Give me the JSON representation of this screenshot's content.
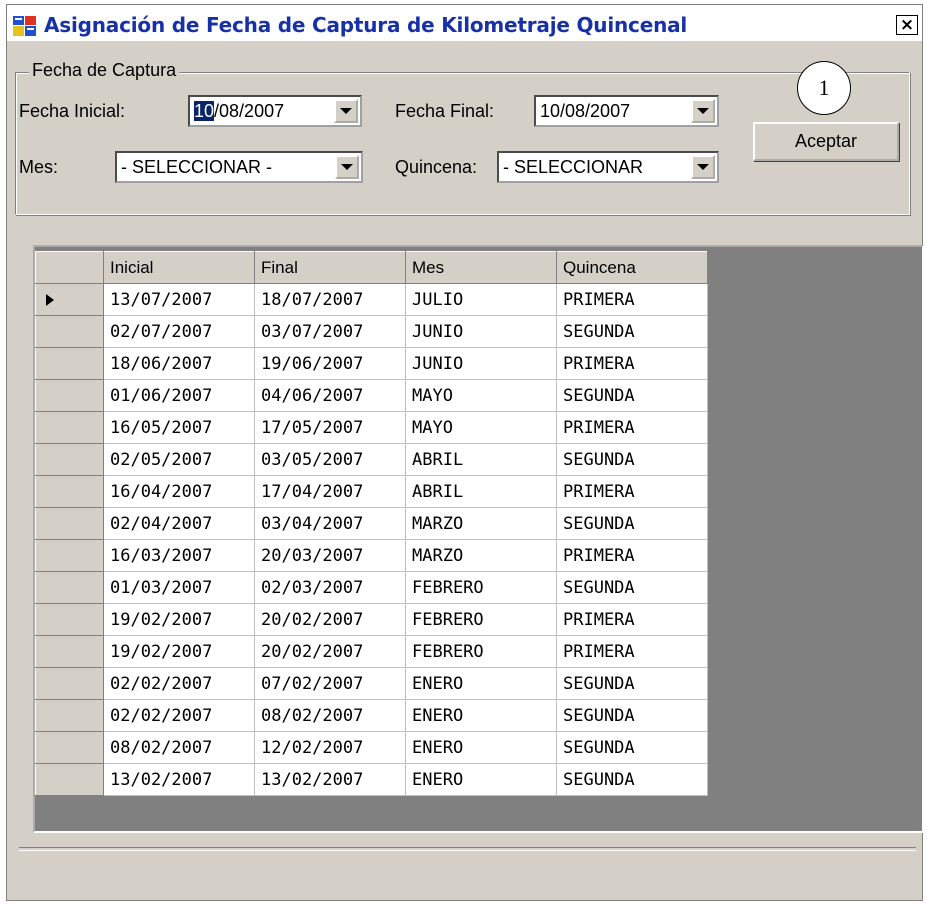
{
  "window": {
    "title": "Asignación de Fecha de Captura de Kilometraje Quincenal",
    "close_label": "×"
  },
  "group": {
    "legend": "Fecha de Captura",
    "fecha_inicial_label": "Fecha Inicial:",
    "fecha_inicial_selected": "10",
    "fecha_inicial_rest": "/08/2007",
    "fecha_final_label": "Fecha Final:",
    "fecha_final_value": "10/08/2007",
    "mes_label": "Mes:",
    "mes_value": "- SELECCIONAR -",
    "quincena_label": "Quincena:",
    "quincena_value": "- SELECCIONAR"
  },
  "accept_button": "Aceptar",
  "callout_number": "1",
  "grid": {
    "columns": [
      "Inicial",
      "Final",
      "Mes",
      "Quincena"
    ],
    "rows": [
      [
        "13/07/2007",
        "18/07/2007",
        "JULIO",
        "PRIMERA"
      ],
      [
        "02/07/2007",
        "03/07/2007",
        "JUNIO",
        "SEGUNDA"
      ],
      [
        "18/06/2007",
        "19/06/2007",
        "JUNIO",
        "PRIMERA"
      ],
      [
        "01/06/2007",
        "04/06/2007",
        "MAYO",
        "SEGUNDA"
      ],
      [
        "16/05/2007",
        "17/05/2007",
        "MAYO",
        "PRIMERA"
      ],
      [
        "02/05/2007",
        "03/05/2007",
        "ABRIL",
        "SEGUNDA"
      ],
      [
        "16/04/2007",
        "17/04/2007",
        "ABRIL",
        "PRIMERA"
      ],
      [
        "02/04/2007",
        "03/04/2007",
        "MARZO",
        "SEGUNDA"
      ],
      [
        "16/03/2007",
        "20/03/2007",
        "MARZO",
        "PRIMERA"
      ],
      [
        "01/03/2007",
        "02/03/2007",
        "FEBRERO",
        "SEGUNDA"
      ],
      [
        "19/02/2007",
        "20/02/2007",
        "FEBRERO",
        "PRIMERA"
      ],
      [
        "19/02/2007",
        "20/02/2007",
        "FEBRERO",
        "PRIMERA"
      ],
      [
        "02/02/2007",
        "07/02/2007",
        "ENERO",
        "SEGUNDA"
      ],
      [
        "02/02/2007",
        "08/02/2007",
        "ENERO",
        "SEGUNDA"
      ],
      [
        "08/02/2007",
        "12/02/2007",
        "ENERO",
        "SEGUNDA"
      ],
      [
        "13/02/2007",
        "13/02/2007",
        "ENERO",
        "SEGUNDA"
      ]
    ],
    "current_row": 0
  }
}
